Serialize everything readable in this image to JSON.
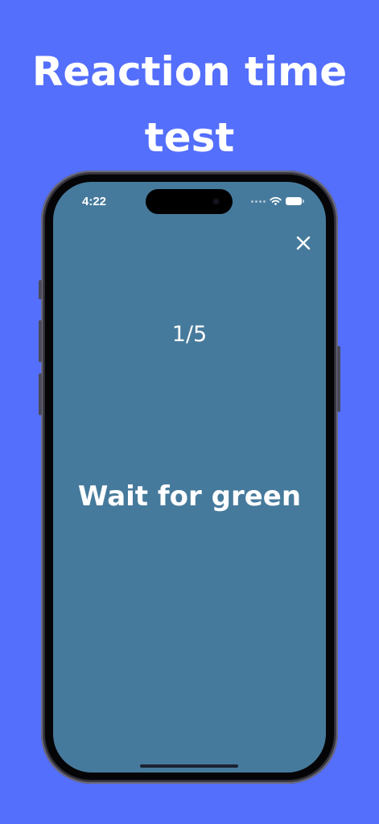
{
  "headline": "Reaction time test",
  "status_bar": {
    "time": "4:22",
    "icons": [
      "signal-dots-icon",
      "wifi-icon",
      "battery-icon"
    ]
  },
  "screen": {
    "close_icon": "close-icon",
    "counter": "1/5",
    "instruction": "Wait for green"
  },
  "colors": {
    "page_background": "#546ffb",
    "screen_background": "#467a9c",
    "text": "#ffffff"
  }
}
